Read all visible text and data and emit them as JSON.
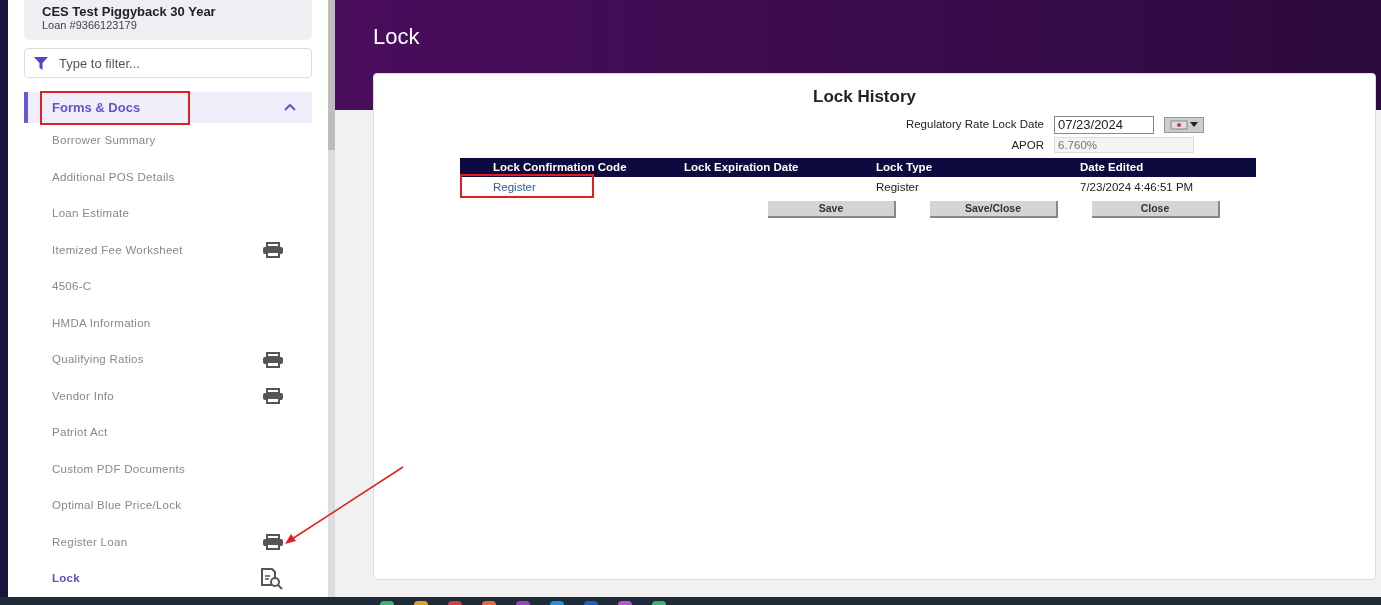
{
  "loan": {
    "name": "CES Test Piggyback 30 Year",
    "number": "Loan #9366123179"
  },
  "filter": {
    "placeholder": "Type to filter..."
  },
  "section": {
    "label": "Forms & Docs",
    "expanded": true,
    "highlighted": true
  },
  "sidebar": {
    "items": [
      {
        "label": "Borrower Summary",
        "kind": "plain",
        "selected": false
      },
      {
        "label": "Additional POS Details",
        "kind": "plain",
        "selected": false
      },
      {
        "label": "Loan Estimate",
        "kind": "plain",
        "selected": false
      },
      {
        "label": "Itemized Fee Worksheet",
        "kind": "print",
        "selected": false
      },
      {
        "label": "4506-C",
        "kind": "plain",
        "selected": false
      },
      {
        "label": "HMDA Information",
        "kind": "plain",
        "selected": false
      },
      {
        "label": "Qualifying Ratios",
        "kind": "print",
        "selected": false
      },
      {
        "label": "Vendor Info",
        "kind": "print",
        "selected": false
      },
      {
        "label": "Patriot Act",
        "kind": "plain",
        "selected": false
      },
      {
        "label": "Custom PDF Documents",
        "kind": "plain",
        "selected": false
      },
      {
        "label": "Optimal Blue Price/Lock",
        "kind": "plain",
        "selected": false
      },
      {
        "label": "Register Loan",
        "kind": "print",
        "selected": false,
        "arrow": true
      },
      {
        "label": "Lock",
        "kind": "preview",
        "selected": true
      }
    ]
  },
  "page_title": "Lock",
  "card": {
    "title": "Lock History",
    "fields": [
      {
        "label": "Regulatory Rate Lock Date",
        "value": "07/23/2024",
        "kind": "date"
      },
      {
        "label": "APOR",
        "value": "6.760%",
        "kind": "readonly"
      }
    ],
    "table": {
      "columns": [
        "Lock Confirmation Code",
        "Lock Expiration Date",
        "Lock Type",
        "Date Edited"
      ],
      "rows": [
        {
          "code": "Register",
          "highlighted": true,
          "type": "Register",
          "edited": "7/23/2024 4:46:51 PM"
        }
      ]
    },
    "buttons": [
      "Save",
      "Save/Close",
      "Close"
    ]
  }
}
